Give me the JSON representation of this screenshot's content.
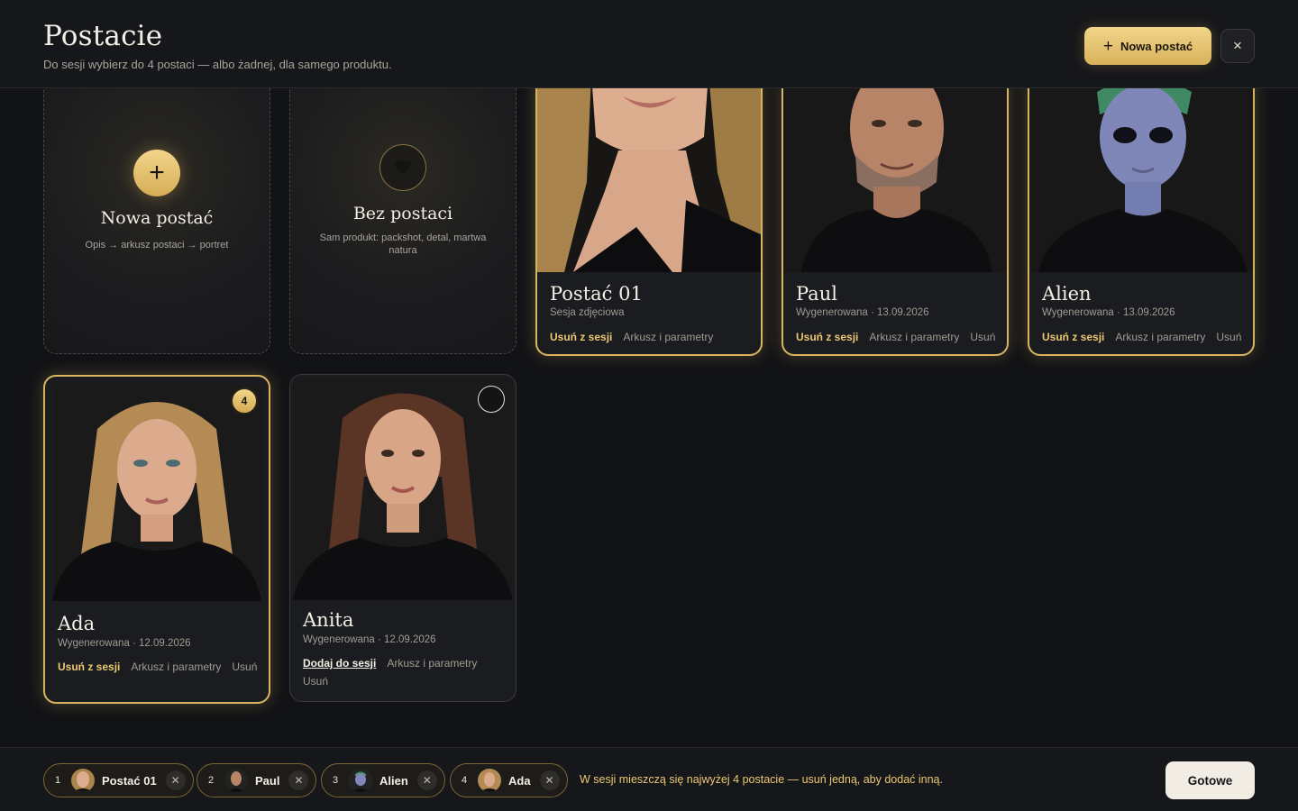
{
  "header": {
    "title": "Postacie",
    "subtitle": "Do sesji wybierz do 4 postaci — albo żadnej, dla samego produktu.",
    "new_button": "Nowa postać",
    "close_icon": "×"
  },
  "tiles": {
    "new": {
      "title": "Nowa postać",
      "desc": "Opis → arkusz postaci → portret"
    },
    "none": {
      "title": "Bez postaci",
      "desc": "Sam produkt: packshot, detal, martwa natura"
    }
  },
  "cards": [
    {
      "name": "Postać 01",
      "meta": "Sesja zdjęciowa",
      "actions": [
        "Usuń z sesji",
        "Arkusz i parametry"
      ]
    },
    {
      "name": "Paul",
      "meta": "Wygenerowana · 13.09.2026",
      "actions": [
        "Usuń z sesji",
        "Arkusz i parametry",
        "Usuń"
      ]
    },
    {
      "name": "Alien",
      "meta": "Wygenerowana · 13.09.2026",
      "actions": [
        "Usuń z sesji",
        "Arkusz i parametry",
        "Usuń"
      ]
    },
    {
      "name": "Ada",
      "meta": "Wygenerowana · 12.09.2026",
      "badge": "4",
      "actions": [
        "Usuń z sesji",
        "Arkusz i parametry",
        "Usuń"
      ]
    },
    {
      "name": "Anita",
      "meta": "Wygenerowana · 12.09.2026",
      "actions": [
        "Dodaj do sesji",
        "Arkusz i parametry",
        "Usuń"
      ]
    }
  ],
  "session": {
    "chips": [
      {
        "num": "1",
        "label": "Postać 01"
      },
      {
        "num": "2",
        "label": "Paul"
      },
      {
        "num": "3",
        "label": "Alien"
      },
      {
        "num": "4",
        "label": "Ada"
      }
    ],
    "message": "W sesji mieszczą się najwyżej 4 postacie — usuń jedną, aby dodać inną.",
    "done_button": "Gotowe"
  },
  "colors": {
    "accent_gold": "#d9b460",
    "background": "#121316"
  }
}
